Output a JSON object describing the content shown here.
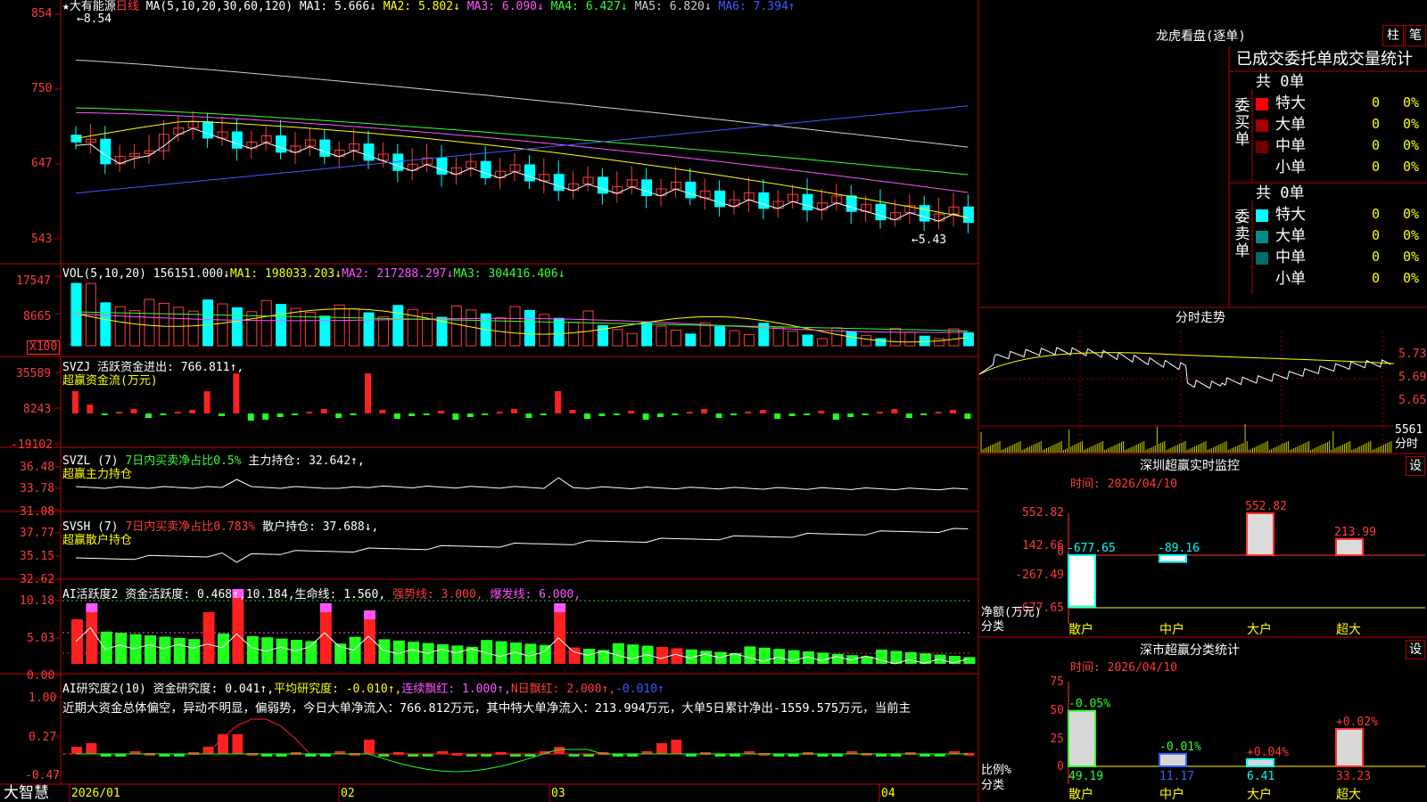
{
  "left": {
    "title_star": "★",
    "stock_name": "大有能源",
    "period": "日线",
    "ma_params": "MA(5,10,20,30,60,120)",
    "ma_values": [
      {
        "label": "MA1:",
        "value": "5.666↓",
        "color": "#ffffff"
      },
      {
        "label": "MA2:",
        "value": "5.802↓",
        "color": "#ffff00"
      },
      {
        "label": "MA3:",
        "value": "6.090↓",
        "color": "#ff55ff"
      },
      {
        "label": "MA4:",
        "value": "6.427↓",
        "color": "#33ff33"
      },
      {
        "label": "MA5:",
        "value": "6.820↓",
        "color": "#cfcfcf"
      },
      {
        "label": "MA6:",
        "value": "7.394↑",
        "color": "#3f5bff"
      }
    ],
    "price_axis": [
      "854",
      "750",
      "647",
      "543"
    ],
    "high_marker": "←8.54",
    "low_marker": "←5.43",
    "vol": {
      "label": "VOL(5,10,20)",
      "value": "156151.000↓",
      "ma1": "MA1: 198033.203↓",
      "ma2": "MA2: 217288.297↓",
      "ma3": "MA3: 304416.406↓",
      "axis": [
        "17547",
        "8665"
      ],
      "unit": "X100"
    },
    "svzj": {
      "label": "SVZJ",
      "text": "活跃资金进出: 766.811↑,",
      "sub": "超赢资金流(万元)",
      "axis": [
        "35589",
        "8243",
        "-19102"
      ]
    },
    "svzl": {
      "label": "SVZL (7)",
      "text1": "7日内买卖净占比0.5%",
      "text2": "主力持仓: 32.642↑,",
      "sub": "超赢主力持仓",
      "axis": [
        "36.48",
        "33.78",
        "31.08"
      ]
    },
    "svsh": {
      "label": "SVSH (7)",
      "text1": "7日内买卖净占比0.783%",
      "text2": "散户持仓: 37.688↓,",
      "sub": "超赢散户持仓",
      "axis": [
        "37.77",
        "35.15",
        "32.62"
      ]
    },
    "ai1": {
      "label": "AI活跃度2",
      "text": "资金活跃度: 0.468↑,10.184,",
      "life": "生命线: 1.560,",
      "strong": "强势线: 3.000,",
      "burst": "爆发线: 6.000,",
      "axis": [
        "10.18",
        "5.03",
        "0.00"
      ]
    },
    "ai2": {
      "label": "AI研究度2(10)",
      "text": "资金研究度: 0.041↑,",
      "avg": "平均研究度: -0.010↑,",
      "cont": "连续飘红: 1.000↑,",
      "nday": "N日飘红: 2.000↑,",
      "tail": "-0.010↑",
      "axis": [
        "1.00",
        "0.27",
        "-0.47"
      ],
      "comment": "近期大资金总体偏空，异动不明显，偏弱势，今日大单净流入：766.812万元，其中特大单净流入：213.994万元，大单5日累计净出-1559.575万元，当前主"
    },
    "dates": [
      "2026/01",
      "02",
      "03",
      "04"
    ],
    "brand": "大智慧"
  },
  "right": {
    "lhb_title": "龙虎看盘(逐单)",
    "btn_zhu": "柱",
    "btn_bi": "笔",
    "stat_title": "已成交委托单成交量统计",
    "buy_total": "共 0单",
    "buy_label": "委买单",
    "sell_total": "共 0单",
    "sell_label": "委卖单",
    "buy_rows": [
      {
        "name": "特大",
        "count": "0",
        "pct": "0%",
        "color": "#ff0000"
      },
      {
        "name": "大单",
        "count": "0",
        "pct": "0%",
        "color": "#a00000"
      },
      {
        "name": "中单",
        "count": "0",
        "pct": "0%",
        "color": "#700000"
      },
      {
        "name": "小单",
        "count": "0",
        "pct": "0%",
        "color": "#000000"
      }
    ],
    "sell_rows": [
      {
        "name": "特大",
        "count": "0",
        "pct": "0%",
        "color": "#00ffff"
      },
      {
        "name": "大单",
        "count": "0",
        "pct": "0%",
        "color": "#008b8b"
      },
      {
        "name": "中单",
        "count": "0",
        "pct": "0%",
        "color": "#006b6b"
      },
      {
        "name": "小单",
        "count": "0",
        "pct": "0%",
        "color": "#000000"
      }
    ],
    "intraday_title": "分时走势",
    "intraday_axis": [
      "5.73",
      "5.69",
      "5.65"
    ],
    "intraday_vol": "5561",
    "intraday_unit": "分时",
    "monitor_title": "深圳超赢实时监控",
    "set_label": "设",
    "monitor_time": "时间: 2026/04/10",
    "monitor_axis": [
      "552.82",
      "142.66",
      "0",
      "-267.49",
      "-677.65"
    ],
    "monitor_ylabel": "净额(万元)",
    "monitor_xlabel": "分类",
    "monitor_values": [
      "-677.65",
      "-89.16",
      "552.82",
      "213.99"
    ],
    "categories": [
      "散户",
      "中户",
      "大户",
      "超大"
    ],
    "class_title": "深市超赢分类统计",
    "class_time": "时间: 2026/04/10",
    "class_axis": [
      "75",
      "50",
      "25",
      "0"
    ],
    "class_ylabel": "比例%",
    "class_xlabel": "分类",
    "class_top": [
      "-0.05%",
      "-0.01%",
      "+0.04%",
      "+0.02%"
    ],
    "class_values": [
      "49.19",
      "11.17",
      "6.41",
      "33.23"
    ]
  },
  "chart_data": [
    {
      "type": "bar",
      "title": "深圳超赢实时监控",
      "categories": [
        "散户",
        "中户",
        "大户",
        "超大"
      ],
      "values": [
        -677.65,
        -89.16,
        552.82,
        213.99
      ],
      "ylabel": "净额(万元)",
      "xlabel": "分类",
      "ylim": [
        -677.65,
        552.82
      ]
    },
    {
      "type": "bar",
      "title": "深市超赢分类统计",
      "categories": [
        "散户",
        "中户",
        "大户",
        "超大"
      ],
      "values": [
        49.19,
        11.17,
        6.41,
        33.23
      ],
      "ylabel": "比例%",
      "xlabel": "分类",
      "ylim": [
        0,
        75
      ]
    }
  ]
}
